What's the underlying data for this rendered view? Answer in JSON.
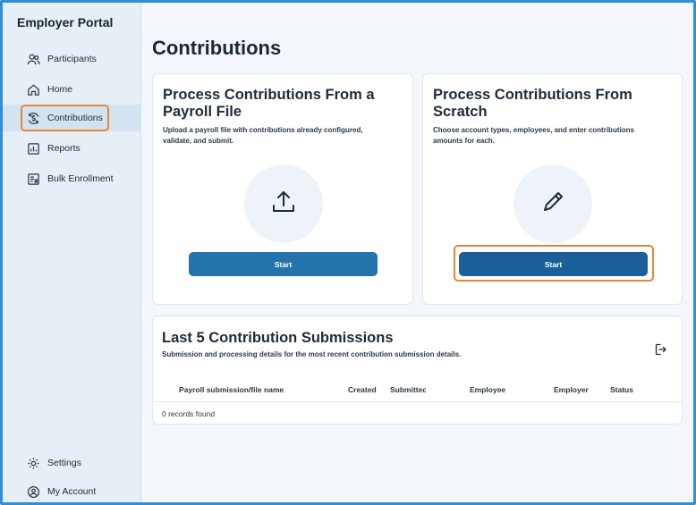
{
  "sidebar": {
    "brand": "Employer Portal",
    "items": [
      {
        "label": "Participants"
      },
      {
        "label": "Home"
      },
      {
        "label": "Contributions"
      },
      {
        "label": "Reports"
      },
      {
        "label": "Bulk Enrollment"
      }
    ],
    "bottom": [
      {
        "label": "Settings"
      },
      {
        "label": "My Account"
      }
    ]
  },
  "page": {
    "title": "Contributions"
  },
  "cards": [
    {
      "title": "Process Contributions From a Payroll File",
      "description": "Upload a payroll file with contributions already configured, validate, and submit.",
      "icon": "upload-icon",
      "button": "Start"
    },
    {
      "title": "Process Contributions From Scratch",
      "description": "Choose account types, employees, and enter contributions amounts for each.",
      "icon": "pencil-icon",
      "button": "Start"
    }
  ],
  "submissions": {
    "title": "Last 5 Contribution Submissions",
    "description": "Submission and processing details for the most recent contribution submission details.",
    "columns": [
      "Payroll submission/file name",
      "Created",
      "Submitted",
      "Employee",
      "Employer",
      "Status"
    ],
    "empty": "0 records found"
  },
  "colors": {
    "accent": "#2474ab",
    "accent_dark": "#1a5f98",
    "highlight": "#e8843a",
    "frame": "#2f8ed6"
  }
}
